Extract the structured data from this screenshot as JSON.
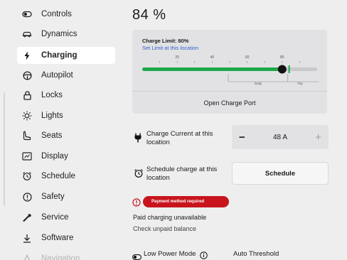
{
  "sidebar": {
    "items": [
      {
        "label": "Controls",
        "icon": "toggle-icon",
        "active": false
      },
      {
        "label": "Dynamics",
        "icon": "car-icon",
        "active": false
      },
      {
        "label": "Charging",
        "icon": "bolt-icon",
        "active": true
      },
      {
        "label": "Autopilot",
        "icon": "steering-wheel-icon",
        "active": false
      },
      {
        "label": "Locks",
        "icon": "lock-icon",
        "active": false
      },
      {
        "label": "Lights",
        "icon": "sun-icon",
        "active": false
      },
      {
        "label": "Seats",
        "icon": "seat-icon",
        "active": false
      },
      {
        "label": "Display",
        "icon": "display-icon",
        "active": false
      },
      {
        "label": "Schedule",
        "icon": "alarm-clock-icon",
        "active": false
      },
      {
        "label": "Safety",
        "icon": "alert-circle-icon",
        "active": false
      },
      {
        "label": "Service",
        "icon": "wrench-icon",
        "active": false
      },
      {
        "label": "Software",
        "icon": "download-icon",
        "active": false
      },
      {
        "label": "Navigation",
        "icon": "navigation-icon",
        "active": false
      }
    ]
  },
  "charging": {
    "battery_percent": "84 %",
    "charge_limit_label": "Charge Limit: 80%",
    "set_limit_link": "Set Limit at this location",
    "charge_limit_value": 80,
    "current_level": 84,
    "scale_ticks": [
      "20",
      "40",
      "60",
      "80"
    ],
    "zone_labels": {
      "daily": "Daily",
      "trip": "Trip"
    },
    "open_port_label": "Open Charge Port",
    "charge_current": {
      "label_line1": "Charge Current at this",
      "label_line2": "location",
      "value": "48 A",
      "minus": "−",
      "plus": "+"
    },
    "schedule": {
      "label_line1": "Schedule charge at this",
      "label_line2": "location",
      "button": "Schedule"
    },
    "alert": {
      "badge": "Payment method required",
      "title": "Paid charging unavailable",
      "subtitle": "Check unpaid balance"
    },
    "low_power": {
      "label": "Low Power Mode",
      "threshold": "Auto Threshold"
    }
  },
  "colors": {
    "accent_green": "#1fa84b",
    "link_blue": "#2f5fd0",
    "alert_red": "#c8151d"
  }
}
